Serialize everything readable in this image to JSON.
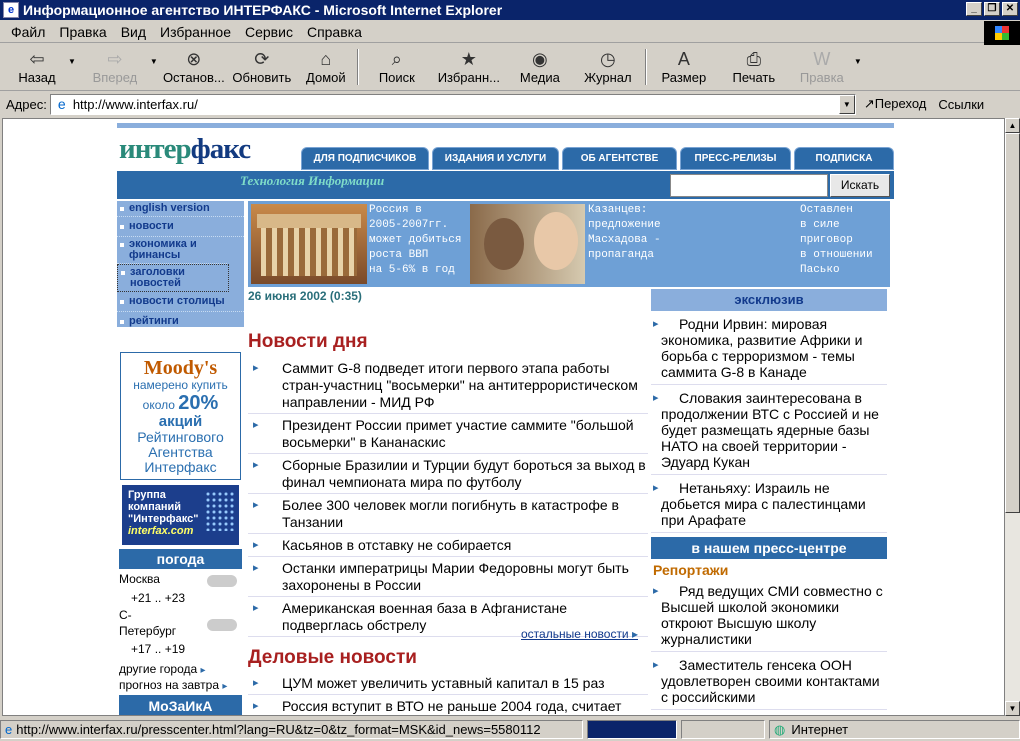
{
  "window": {
    "title": "Информационное агентство ИНТЕРФАКС - Microsoft Internet Explorer"
  },
  "menu": [
    "Файл",
    "Правка",
    "Вид",
    "Избранное",
    "Сервис",
    "Справка"
  ],
  "toolbar": {
    "back": "Назад",
    "forward": "Вперед",
    "stop": "Останов...",
    "refresh": "Обновить",
    "home": "Домой",
    "search": "Поиск",
    "favorites": "Избранн...",
    "media": "Медиа",
    "history": "Журнал",
    "size": "Размер",
    "print": "Печать",
    "edit": "Правка"
  },
  "address": {
    "label": "Адрес:",
    "url": "http://www.interfax.ru/",
    "go": "Переход",
    "links": "Ссылки"
  },
  "status": {
    "url": "http://www.interfax.ru/presscenter.html?lang=RU&tz=0&tz_format=MSK&id_news=5580112",
    "zone": "Интернет"
  },
  "site": {
    "logo_a": "интер",
    "logo_b": "факс",
    "slogan": "Технология Информации",
    "tabs": [
      "для подписчиков",
      "издания и услуги",
      "об агентстве",
      "пресс-релизы",
      "подписка"
    ],
    "search_btn": "Искать",
    "nav": [
      "english version",
      "новости",
      "экономика и финансы",
      "заголовки новостей",
      "новости столицы",
      "рейтинги"
    ],
    "moody": {
      "brand": "Moody's",
      "l1": "намерено купить",
      "l2": "около",
      "pct": "20%",
      "l3": "акций",
      "l4": "Рейтингового",
      "l5": "Агентства",
      "l6": "Интерфакс"
    },
    "group": {
      "l1": "Группа",
      "l2": "компаний",
      "l3": "\"Интерфакс\"",
      "l4": "interfax.com"
    },
    "weather": {
      "title": "погода",
      "city1": "Москва",
      "t1": "+21 .. +23",
      "city2a": "С-",
      "city2b": "Петербург",
      "t2": "+17 .. +19",
      "other": "другие города",
      "tomorrow": "прогноз на завтра"
    },
    "mosaic": "МоЗаИкА",
    "banner": {
      "a": [
        "Россия в",
        "2005-2007гг.",
        "может добиться",
        "роста ВВП",
        "на 5-6% в год"
      ],
      "b": [
        "Казанцев:",
        "предложение",
        "Масхадова -",
        "пропаганда"
      ],
      "c": [
        "Оставлен",
        "в силе",
        "приговор",
        "в отношении",
        "Пасько"
      ]
    },
    "date": "26 июня 2002 (0:35)",
    "news_title": "Новости дня",
    "news": [
      "Саммит G-8 подведет итоги первого этапа работы стран-участниц \"восьмерки\" на антитеррористическом направлении - МИД РФ",
      "Президент России примет участие саммите \"большой восьмерки\" в Кананаскис",
      "Сборные Бразилии и Турции будут бороться за выход в финал чемпионата мира по футболу",
      "Более 300 человек могли погибнуть в катастрофе в Танзании",
      "Касьянов в отставку не собирается",
      "Останки императрицы Марии Федоровны могут быть захоронены в России",
      "Американская военная база в Афганистане подверглась обстрелу"
    ],
    "more": "остальные новости",
    "biz_title": "Деловые новости",
    "biz": [
      "ЦУМ может увеличить уставный капитал в 15 раз",
      "Россия вступит в ВТО не раньше 2004 года, считает"
    ],
    "excl_title": "эксклюзив",
    "excl": [
      "Родни Ирвин: мировая экономика, развитие Африки и борьба с терроризмом - темы саммита G-8 в Канаде",
      "Словакия заинтересована в продолжении ВТС с Россией и не будет размещать ядерные базы НАТО на своей территории - Эдуард Кукан",
      "Нетаньяху: Израиль не добьется мира с палестинцами при Арафате"
    ],
    "press_title": "в нашем пресс-центре",
    "reports": "Репортажи",
    "press": [
      "Ряд ведущих СМИ совместно с Высшей школой экономики откроют Высшую школу журналистики",
      "Заместитель генсека ООН удовлетворен своими контактами с российскими"
    ]
  }
}
